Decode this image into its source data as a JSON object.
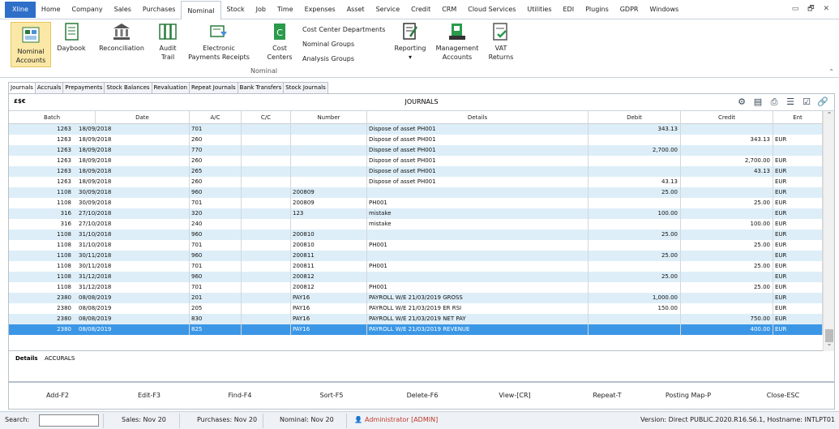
{
  "menu": {
    "items": [
      "Xline",
      "Home",
      "Company",
      "Sales",
      "Purchases",
      "Nominal",
      "Stock",
      "Job",
      "Time",
      "Expenses",
      "Asset",
      "Service",
      "Credit",
      "CRM",
      "Cloud Services",
      "Utilities",
      "EDI",
      "Plugins",
      "GDPR",
      "Windows"
    ],
    "active": "Nominal",
    "window_controls": "▭ 🗗 ✕"
  },
  "ribbon": {
    "nominal_accounts": "Nominal\nAccounts",
    "daybook": "Daybook",
    "reconciliation": "Reconciliation",
    "audit_trail": "Audit\nTrail",
    "electronic_payments": "Electronic\nPayments Receipts",
    "cost_centers": "Cost\nCenters",
    "cost_center_departments": "Cost Center Departments",
    "nominal_groups": "Nominal Groups",
    "analysis_groups": "Analysis Groups",
    "reporting": "Reporting",
    "management_accounts": "Management\nAccounts",
    "vat_returns": "VAT\nReturns",
    "group_label": "Nominal",
    "collapse": "⌃"
  },
  "tabs": [
    "Journals",
    "Accruals",
    "Prepayments",
    "Stock Balances",
    "Revaluation",
    "Repeat Journals",
    "Bank Transfers",
    "Stock Journals"
  ],
  "panel": {
    "currency": "£$€",
    "title": "JOURNALS"
  },
  "table": {
    "headers": [
      "Batch",
      "Date",
      "A/C",
      "C/C",
      "Number",
      "Details",
      "Debit",
      "Credit",
      "Ent"
    ],
    "rows": [
      [
        "1263",
        "18/09/2018",
        "701",
        "",
        "",
        "Dispose of asset PH001",
        "343.13",
        "",
        ""
      ],
      [
        "1263",
        "18/09/2018",
        "260",
        "",
        "",
        "Dispose of asset PH001",
        "",
        "343.13",
        "EUR"
      ],
      [
        "1263",
        "18/09/2018",
        "770",
        "",
        "",
        "Dispose of asset PH001",
        "2,700.00",
        "",
        ""
      ],
      [
        "1263",
        "18/09/2018",
        "260",
        "",
        "",
        "Dispose of asset PH001",
        "",
        "2,700.00",
        "EUR"
      ],
      [
        "1263",
        "18/09/2018",
        "265",
        "",
        "",
        "Dispose of asset PH001",
        "",
        "43.13",
        "EUR"
      ],
      [
        "1263",
        "18/09/2018",
        "260",
        "",
        "",
        "Dispose of asset PH001",
        "43.13",
        "",
        "EUR"
      ],
      [
        "1108",
        "30/09/2018",
        "960",
        "",
        "200809",
        "",
        "25.00",
        "",
        "EUR"
      ],
      [
        "1108",
        "30/09/2018",
        "701",
        "",
        "200809",
        "PH001",
        "",
        "25.00",
        "EUR"
      ],
      [
        "316",
        "27/10/2018",
        "320",
        "",
        "123",
        "mistake",
        "100.00",
        "",
        "EUR"
      ],
      [
        "316",
        "27/10/2018",
        "240",
        "",
        "",
        "mistake",
        "",
        "100.00",
        "EUR"
      ],
      [
        "1108",
        "31/10/2018",
        "960",
        "",
        "200810",
        "",
        "25.00",
        "",
        "EUR"
      ],
      [
        "1108",
        "31/10/2018",
        "701",
        "",
        "200810",
        "PH001",
        "",
        "25.00",
        "EUR"
      ],
      [
        "1108",
        "30/11/2018",
        "960",
        "",
        "200811",
        "",
        "25.00",
        "",
        "EUR"
      ],
      [
        "1108",
        "30/11/2018",
        "701",
        "",
        "200811",
        "PH001",
        "",
        "25.00",
        "EUR"
      ],
      [
        "1108",
        "31/12/2018",
        "960",
        "",
        "200812",
        "",
        "25.00",
        "",
        "EUR"
      ],
      [
        "1108",
        "31/12/2018",
        "701",
        "",
        "200812",
        "PH001",
        "",
        "25.00",
        "EUR"
      ],
      [
        "2380",
        "08/08/2019",
        "201",
        "",
        "PAY16",
        "PAYROLL W/E 21/03/2019 GROSS",
        "1,000.00",
        "",
        "EUR"
      ],
      [
        "2380",
        "08/08/2019",
        "205",
        "",
        "PAY16",
        "PAYROLL W/E 21/03/2019 ER RSI",
        "150.00",
        "",
        "EUR"
      ],
      [
        "2380",
        "08/08/2019",
        "830",
        "",
        "PAY16",
        "PAYROLL W/E 21/03/2019 NET PAY",
        "",
        "750.00",
        "EUR"
      ],
      [
        "2380",
        "08/08/2019",
        "825",
        "",
        "PAY16",
        "PAYROLL W/E 21/03/2019 REVENUE",
        "",
        "400.00",
        "EUR"
      ]
    ],
    "selected_row": 19
  },
  "details": {
    "label": "Details",
    "value": "ACCURALS"
  },
  "actions": [
    "Add-F2",
    "Edit-F3",
    "Find-F4",
    "Sort-F5",
    "Delete-F6",
    "View-[CR]",
    "Repeat-T",
    "Posting Map-P",
    "Close-ESC"
  ],
  "status": {
    "search_label": "Search:",
    "sales": "Sales: Nov 20",
    "purchases": "Purchases: Nov 20",
    "nominal": "Nominal: Nov 20",
    "user": "Administrator [ADMIN]",
    "version": "Version: Direct PUBLIC.2020.R16.S6.1, Hostname: INTLPT01"
  }
}
